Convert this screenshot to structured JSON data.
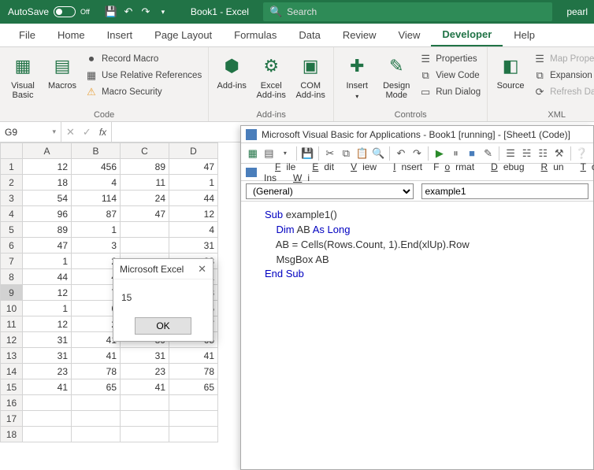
{
  "titlebar": {
    "autosave_label": "AutoSave",
    "autosave_state": "Off",
    "doc_title": "Book1  -  Excel",
    "search_placeholder": "Search",
    "right_text": "pearl"
  },
  "tabs": {
    "items": [
      "File",
      "Home",
      "Insert",
      "Page Layout",
      "Formulas",
      "Data",
      "Review",
      "View",
      "Developer",
      "Help"
    ],
    "active_index": 8
  },
  "ribbon": {
    "code": {
      "label": "Code",
      "visual_basic": "Visual Basic",
      "macros": "Macros",
      "record": "Record Macro",
      "use_rel": "Use Relative References",
      "security": "Macro Security"
    },
    "addins": {
      "label": "Add-ins",
      "addins": "Add-ins",
      "excel_addins": "Excel Add-ins",
      "com_addins": "COM Add-ins"
    },
    "controls": {
      "label": "Controls",
      "insert": "Insert",
      "design": "Design Mode",
      "properties": "Properties",
      "view_code": "View Code",
      "run_dialog": "Run Dialog"
    },
    "xml": {
      "label": "XML",
      "source": "Source",
      "map_props": "Map Properties",
      "expansion": "Expansion Packs",
      "refresh": "Refresh Data"
    }
  },
  "formula_bar": {
    "namebox": "G9"
  },
  "grid": {
    "cols": [
      "A",
      "B",
      "C",
      "D"
    ],
    "rows": [
      {
        "r": 1,
        "c": [
          12,
          456,
          89,
          47
        ]
      },
      {
        "r": 2,
        "c": [
          18,
          4,
          11,
          1
        ]
      },
      {
        "r": 3,
        "c": [
          54,
          114,
          24,
          44
        ]
      },
      {
        "r": 4,
        "c": [
          96,
          87,
          47,
          12
        ]
      },
      {
        "r": 5,
        "c": [
          89,
          1,
          null,
          4
        ]
      },
      {
        "r": 6,
        "c": [
          47,
          3,
          null,
          31
        ]
      },
      {
        "r": 7,
        "c": [
          1,
          2,
          null,
          23
        ]
      },
      {
        "r": 8,
        "c": [
          44,
          4,
          null,
          41
        ]
      },
      {
        "r": 9,
        "c": [
          12,
          7,
          null,
          78
        ]
      },
      {
        "r": 10,
        "c": [
          1,
          6,
          null,
          65
        ]
      },
      {
        "r": 11,
        "c": [
          12,
          2,
          null,
          47
        ]
      },
      {
        "r": 12,
        "c": [
          31,
          41,
          89,
          65
        ]
      },
      {
        "r": 13,
        "c": [
          31,
          41,
          31,
          41
        ]
      },
      {
        "r": 14,
        "c": [
          23,
          78,
          23,
          78
        ]
      },
      {
        "r": 15,
        "c": [
          41,
          65,
          41,
          65
        ]
      },
      {
        "r": 16,
        "c": [
          null,
          null,
          null,
          null
        ]
      },
      {
        "r": 17,
        "c": [
          null,
          null,
          null,
          null
        ]
      },
      {
        "r": 18,
        "c": [
          null,
          null,
          null,
          null
        ]
      }
    ],
    "selected_row": 9
  },
  "msgbox": {
    "title": "Microsoft Excel",
    "body": "15",
    "ok": "OK"
  },
  "vba": {
    "title": "Microsoft Visual Basic for Applications - Book1 [running] - [Sheet1 (Code)]",
    "menu": [
      "File",
      "Edit",
      "View",
      "Insert",
      "Format",
      "Debug",
      "Run",
      "Tools",
      "Add-Ins",
      "Wi"
    ],
    "menu_hotkeys": [
      "F",
      "E",
      "V",
      "I",
      "o",
      "D",
      "R",
      "T",
      "A",
      "W"
    ],
    "dd_left": "(General)",
    "dd_right": "example1",
    "code_lines": [
      {
        "t": "Sub example1()",
        "kw": [
          "Sub"
        ]
      },
      {
        "t": ""
      },
      {
        "t": "    Dim AB As Long",
        "kw": [
          "Dim",
          "As",
          "Long"
        ]
      },
      {
        "t": "    AB = Cells(Rows.Count, 1).End(xlUp).Row"
      },
      {
        "t": ""
      },
      {
        "t": "    MsgBox AB"
      },
      {
        "t": ""
      },
      {
        "t": "End Sub",
        "kw": [
          "End",
          "Sub"
        ]
      }
    ]
  }
}
